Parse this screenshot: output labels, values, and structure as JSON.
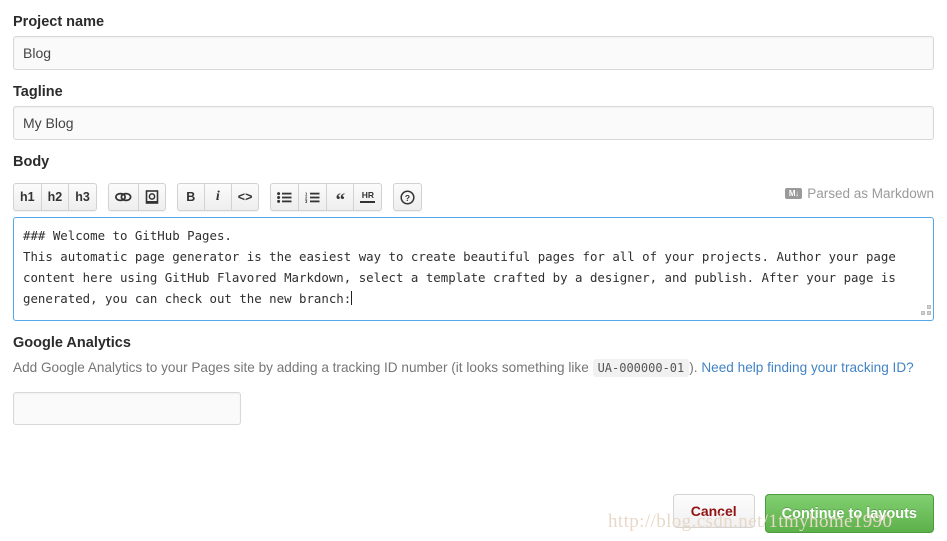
{
  "form": {
    "project_name": {
      "label": "Project name",
      "value": "Blog",
      "placeholder": "Project name"
    },
    "tagline": {
      "label": "Tagline",
      "value": "My Blog",
      "placeholder": "Tagline"
    },
    "body": {
      "label": "Body",
      "value": "### Welcome to GitHub Pages.\nThis automatic page generator is the easiest way to create beautiful pages for all of your projects. Author your page content here using GitHub Flavored Markdown, select a template crafted by a designer, and publish. After your page is generated, you can check out the new branch:",
      "parsed_note": "Parsed as Markdown",
      "markdown_mark": "M↓"
    },
    "google_analytics": {
      "label": "Google Analytics",
      "help_prefix": "Add Google Analytics to your Pages site by adding a tracking ID number (it looks something like",
      "code_example": "UA-000000-01",
      "help_suffix": ").",
      "help_link": "Need help finding your tracking ID?",
      "value": "",
      "placeholder": ""
    }
  },
  "toolbar": {
    "groups": [
      {
        "name": "headings",
        "buttons": [
          {
            "name": "h1",
            "label": "h1",
            "icon": ""
          },
          {
            "name": "h2",
            "label": "h2",
            "icon": ""
          },
          {
            "name": "h3",
            "label": "h3",
            "icon": ""
          }
        ]
      },
      {
        "name": "insert",
        "buttons": [
          {
            "name": "link",
            "label": "",
            "icon": "link-icon"
          },
          {
            "name": "image",
            "label": "",
            "icon": "image-icon"
          }
        ]
      },
      {
        "name": "format",
        "buttons": [
          {
            "name": "bold",
            "label": "B",
            "icon": "bold-icon"
          },
          {
            "name": "italic",
            "label": "i",
            "icon": "italic-icon"
          },
          {
            "name": "code",
            "label": "<>",
            "icon": "code-icon"
          }
        ]
      },
      {
        "name": "blocks",
        "buttons": [
          {
            "name": "unordered-list",
            "label": "",
            "icon": "unordered-list-icon"
          },
          {
            "name": "ordered-list",
            "label": "",
            "icon": "ordered-list-icon"
          },
          {
            "name": "blockquote",
            "label": "“",
            "icon": "quote-icon"
          },
          {
            "name": "horizontal-rule",
            "label": "HR",
            "icon": "hr-icon"
          }
        ]
      },
      {
        "name": "help",
        "buttons": [
          {
            "name": "help",
            "label": "?",
            "icon": "question-circle-icon"
          }
        ]
      }
    ]
  },
  "footer": {
    "cancel_label": "Cancel",
    "continue_label": "Continue to layouts"
  },
  "watermark": {
    "text": "http://blog.csdn.net/1tmyhome1990"
  },
  "colors": {
    "focus_border": "#54a8e8",
    "link": "#4183c4",
    "primary_button": "#5cb14a",
    "cancel_text": "#901212",
    "muted_text": "#767676"
  }
}
